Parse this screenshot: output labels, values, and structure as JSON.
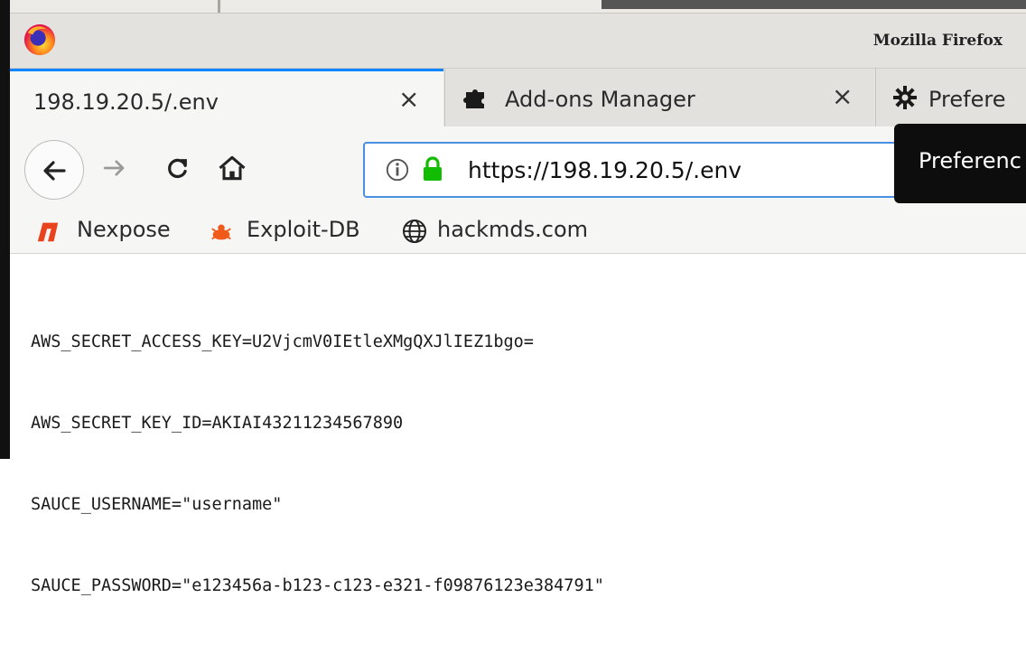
{
  "window": {
    "title": "Mozilla Firefox"
  },
  "tabs": [
    {
      "label": "198.19.20.5/.env",
      "icon": "none",
      "active": true
    },
    {
      "label": "Add-ons Manager",
      "icon": "puzzle-piece-icon",
      "active": false
    },
    {
      "label": "Prefere",
      "icon": "gear-icon",
      "active": false
    }
  ],
  "navbar": {
    "url": "https://198.19.20.5/.env",
    "icons": [
      "back-arrow-icon",
      "forward-arrow-icon",
      "reload-icon",
      "home-icon",
      "info-icon",
      "lock-icon"
    ]
  },
  "tooltip": {
    "text": "Preferenc"
  },
  "bookmarks": [
    {
      "label": "Nexpose",
      "icon": "nexpose-logo-icon"
    },
    {
      "label": "Exploit-DB",
      "icon": "bug-icon"
    },
    {
      "label": "hackmds.com",
      "icon": "globe-icon"
    }
  ],
  "content": {
    "lines": [
      "AWS_SECRET_ACCESS_KEY=U2VjcmV0IEtleXMgQXJlIEZ1bgo=",
      "AWS_SECRET_KEY_ID=AKIAI43211234567890",
      "SAUCE_USERNAME=\"username\"",
      "SAUCE_PASSWORD=\"e123456a-b123-c123-e321-f09876123e384791\""
    ]
  },
  "colors": {
    "accent": "#0a84ff",
    "urlbar_focus": "#4a90e2",
    "lock": "#12bc00",
    "tooltip_bg": "#0d0d0d"
  }
}
